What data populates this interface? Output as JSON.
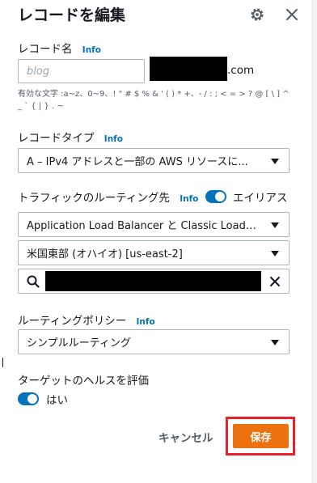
{
  "dialog": {
    "title": "レコードを編集",
    "settings_icon": "gear-icon",
    "close_icon": "close-icon"
  },
  "record_name": {
    "label": "レコード名",
    "info": "Info",
    "placeholder": "blog",
    "domain_suffix": ".com",
    "hint": "有効な文字 :a~z、0~9、! \" # $ % & ' ( ) * +、- / : ; < = > ? @ [ \\ ] ^ _ ` { | } . ~"
  },
  "record_type": {
    "label": "レコードタイプ",
    "info": "Info",
    "selected": "A – IPv4 アドレスと一部の AWS リソースに..."
  },
  "traffic_routing": {
    "label": "トラフィックのルーティング先",
    "info": "Info",
    "alias_label": "エイリアス",
    "alias_enabled": true,
    "endpoint_type": "Application Load Balancer と Classic Load Ba...",
    "region": "米国東部 (オハイオ) [us-east-2]",
    "search_icon": "search-icon",
    "clear_icon": "close-icon"
  },
  "routing_policy": {
    "label": "ルーティングポリシー",
    "info": "Info",
    "selected": "シンプルルーティング"
  },
  "health_check": {
    "label": "ターゲットのヘルスを評価",
    "toggle_label": "はい",
    "enabled": true
  },
  "actions": {
    "cancel_label": "キャンセル",
    "save_label": "保存"
  },
  "colors": {
    "accent": "#0073bb",
    "primary_button": "#ec7211",
    "highlight_frame": "#e8202a"
  }
}
